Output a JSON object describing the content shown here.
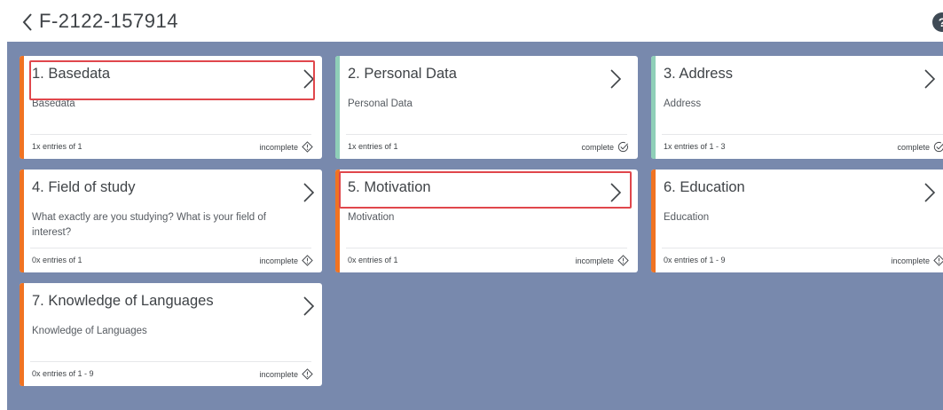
{
  "header": {
    "title": "F-2122-157914",
    "help_label": "?"
  },
  "cards": [
    {
      "title": "1. Basedata",
      "description": "Basedata",
      "entries": "1x entries of 1",
      "status": "incomplete"
    },
    {
      "title": "2. Personal Data",
      "description": "Personal Data",
      "entries": "1x entries of 1",
      "status": "complete"
    },
    {
      "title": "3. Address",
      "description": "Address",
      "entries": "1x entries of 1 - 3",
      "status": "complete"
    },
    {
      "title": "4. Field of study",
      "description": "What exactly are you studying? What is your field of interest?",
      "entries": "0x entries of 1",
      "status": "incomplete"
    },
    {
      "title": "5. Motivation",
      "description": "Motivation",
      "entries": "0x entries of 1",
      "status": "incomplete"
    },
    {
      "title": "6. Education",
      "description": "Education",
      "entries": "0x entries of 1 - 9",
      "status": "incomplete"
    },
    {
      "title": "7. Knowledge of Languages",
      "description": "Knowledge of Languages",
      "entries": "0x entries of 1 - 9",
      "status": "incomplete"
    }
  ],
  "colors": {
    "incomplete_bar": "#f07322",
    "complete_bar": "#8fcfb8",
    "background": "#7889ad",
    "highlight": "#e0474c"
  },
  "icons": {
    "back": "chevron-left-icon",
    "help": "help-icon",
    "card_open": "chevron-right-icon",
    "incomplete": "diamond-info-icon",
    "complete": "check-circle-icon"
  }
}
